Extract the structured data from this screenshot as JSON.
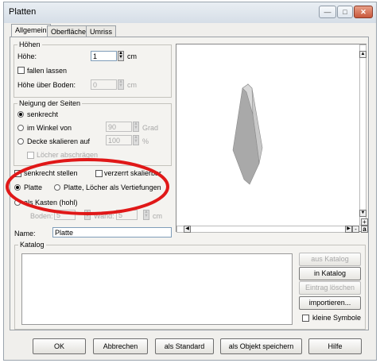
{
  "window": {
    "title": "Platten",
    "btn_minimize": "—",
    "btn_maximize": "□",
    "btn_close": "✕"
  },
  "tabs": [
    {
      "label": "Allgemein"
    },
    {
      "label": "Oberfläche"
    },
    {
      "label": "Umriss"
    }
  ],
  "hoehen": {
    "legend": "Höhen",
    "hoehe_label": "Höhe:",
    "hoehe_value": "1",
    "hoehe_unit": "cm",
    "fallen_lassen": "fallen lassen",
    "hoehe_boden_label": "Höhe über Boden:",
    "hoehe_boden_value": "0",
    "hoehe_boden_unit": "cm"
  },
  "neigung": {
    "legend": "Neigung der Seiten",
    "senkrecht": "senkrecht",
    "im_winkel": "im Winkel von",
    "winkel_value": "90",
    "winkel_unit": "Grad",
    "decke_skalieren": "Decke skalieren auf",
    "decke_value": "100",
    "decke_unit": "%",
    "loecher": "Löcher abschrägen"
  },
  "options": {
    "senkrecht_stellen": "senkrecht stellen",
    "verzerrt": "verzerrt skalierbar",
    "platte": "Platte",
    "platte_loecher": "Platte, Löcher als Vertiefungen",
    "als_kasten": "als Kasten (hohl)",
    "boden_label": "Boden:",
    "boden_value": "5",
    "wand_label": "Wand:",
    "wand_value": "5",
    "wand_unit": "cm"
  },
  "name": {
    "label": "Name:",
    "value": "Platte"
  },
  "katalog": {
    "legend": "Katalog",
    "aus_katalog": "aus Katalog",
    "in_katalog": "in Katalog",
    "eintrag_loeschen": "Eintrag löschen",
    "importieren": "importieren...",
    "kleine_symbole": "kleine Symbole"
  },
  "footer": {
    "ok": "OK",
    "abbrechen": "Abbrechen",
    "als_standard": "als Standard",
    "als_objekt": "als Objekt speichern",
    "hilfe": "Hilfe"
  },
  "preview_zoom": {
    "plus": "+",
    "minus": "-",
    "a": "a"
  },
  "colors": {
    "highlight_circle": "#e01818",
    "shape_face": "#c8c8c8",
    "shape_side": "#a9a9a9"
  }
}
